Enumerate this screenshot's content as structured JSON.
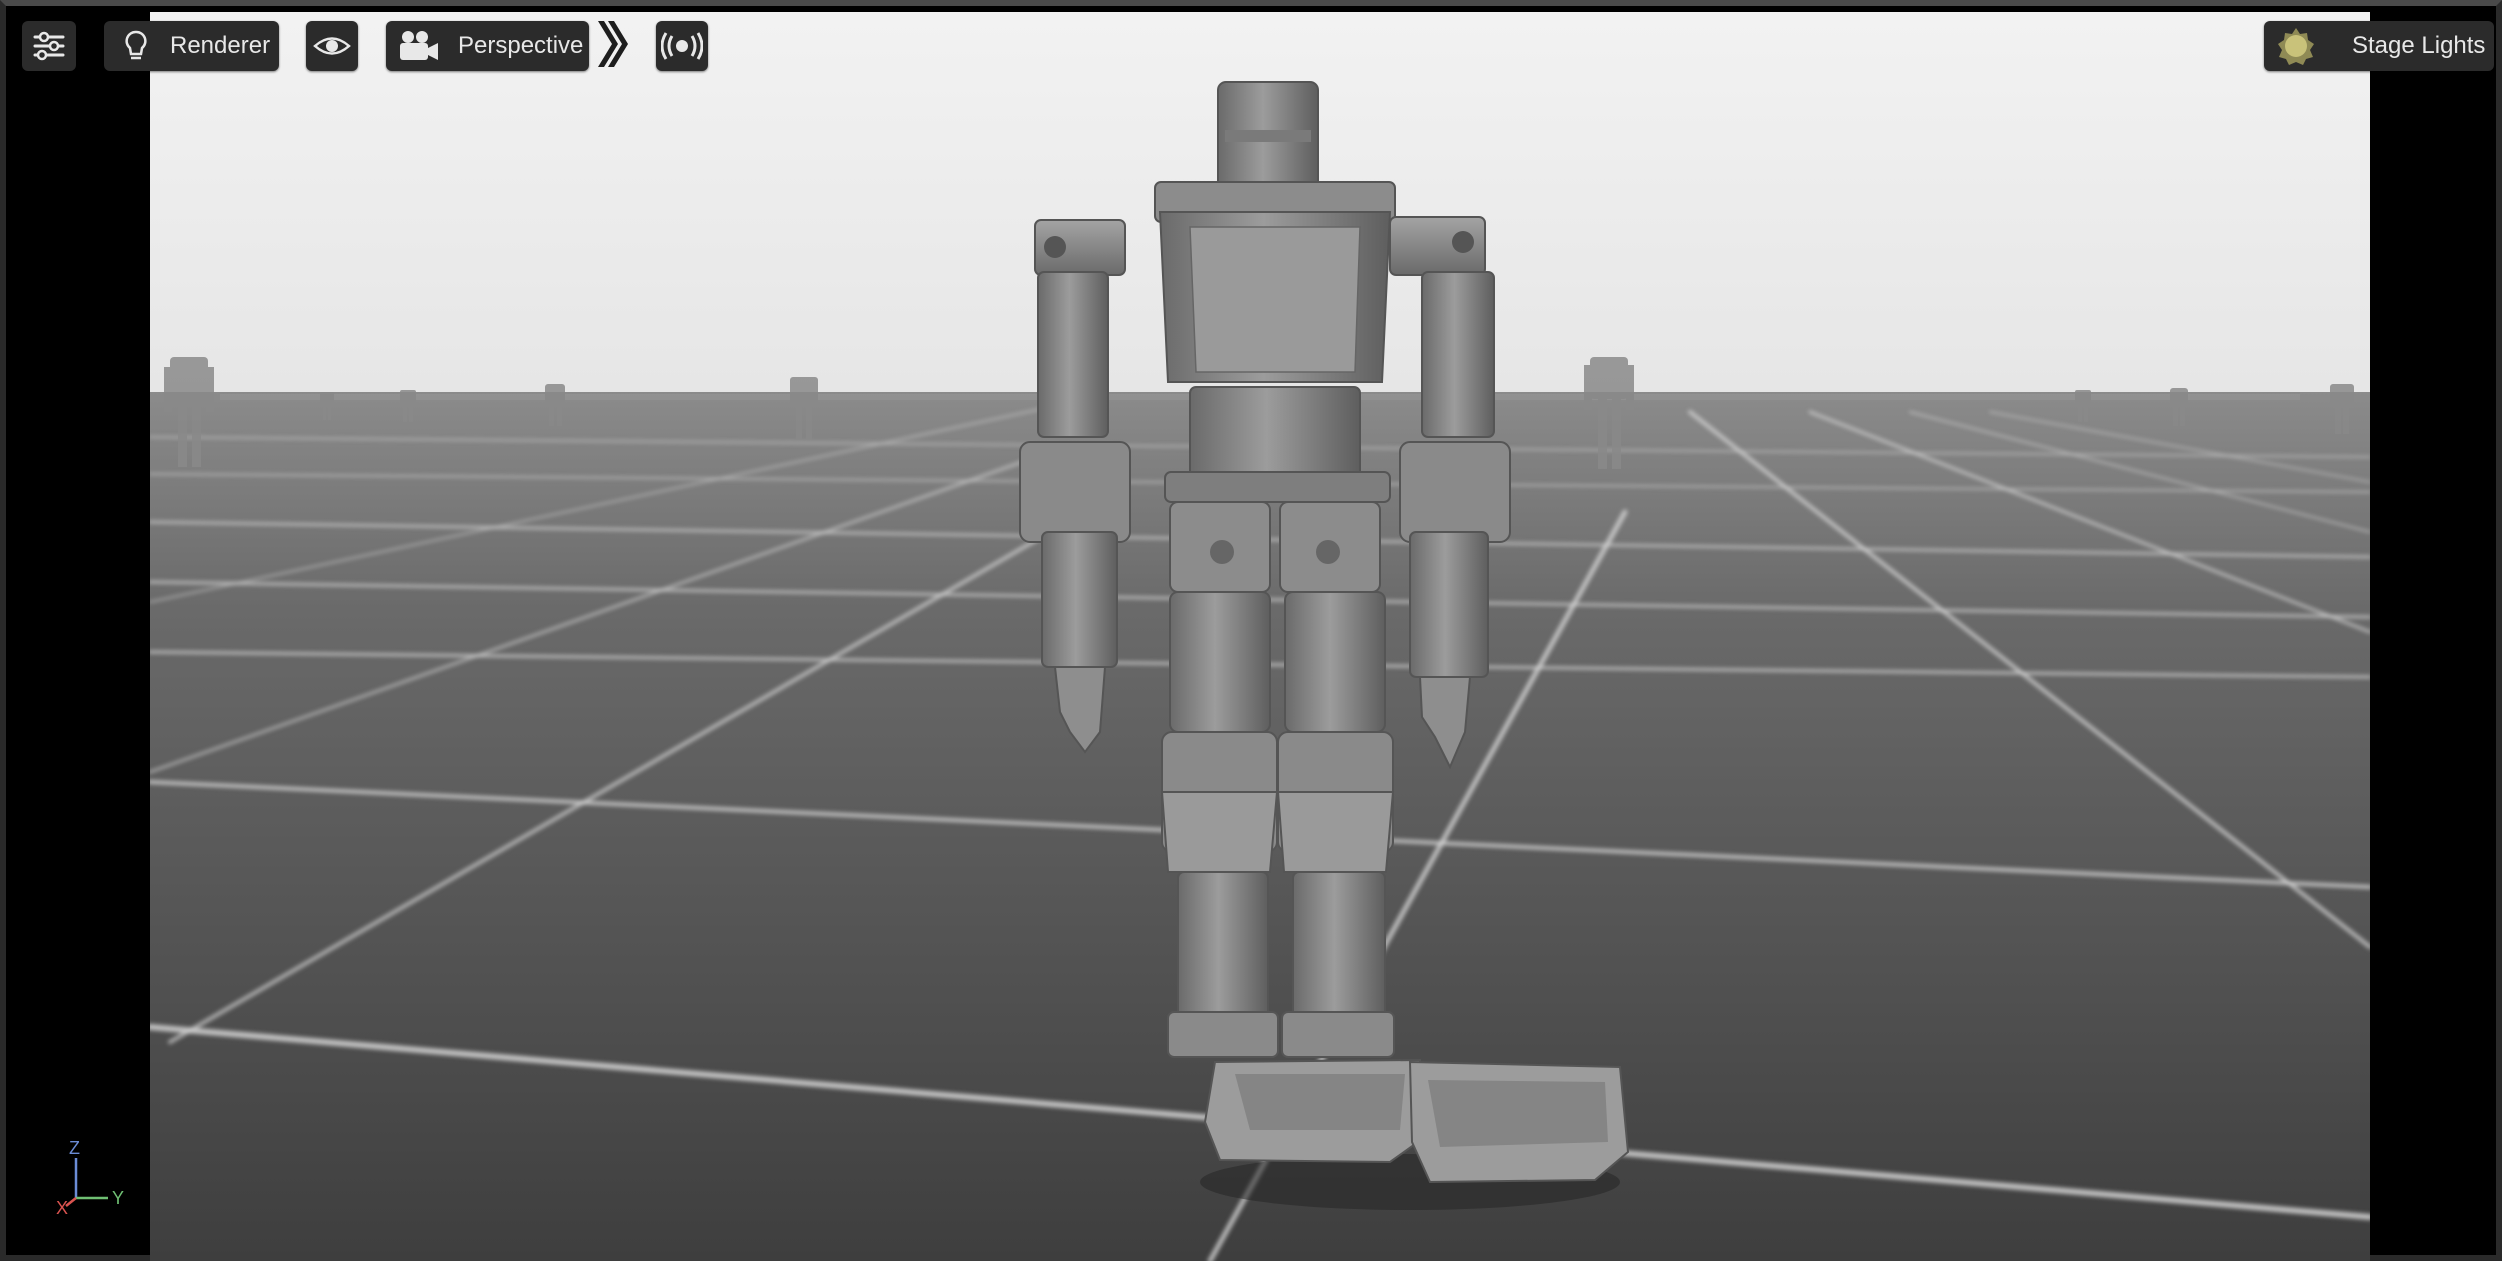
{
  "toolbar": {
    "settings_icon": "sliders-icon",
    "renderer": {
      "label": "Renderer",
      "icon": "lightbulb-icon"
    },
    "visibility_icon": "eye-icon",
    "camera": {
      "label": "Perspective",
      "icon": "video-camera-icon"
    },
    "expand_icon": "double-chevron-right-icon",
    "broadcast_icon": "broadcast-icon",
    "lighting": {
      "label": "Stage Lights",
      "icon": "sun-icon"
    }
  },
  "axis_gizmo": {
    "z": "Z",
    "y": "Y",
    "x": "X"
  },
  "colors": {
    "toolbar_bg": "#2b2b2b",
    "toolbar_text": "#e8e8e8",
    "axis_x": "#d9534f",
    "axis_y": "#6fbf73",
    "axis_z": "#6b8cd6",
    "sun": "#c9c27a"
  }
}
